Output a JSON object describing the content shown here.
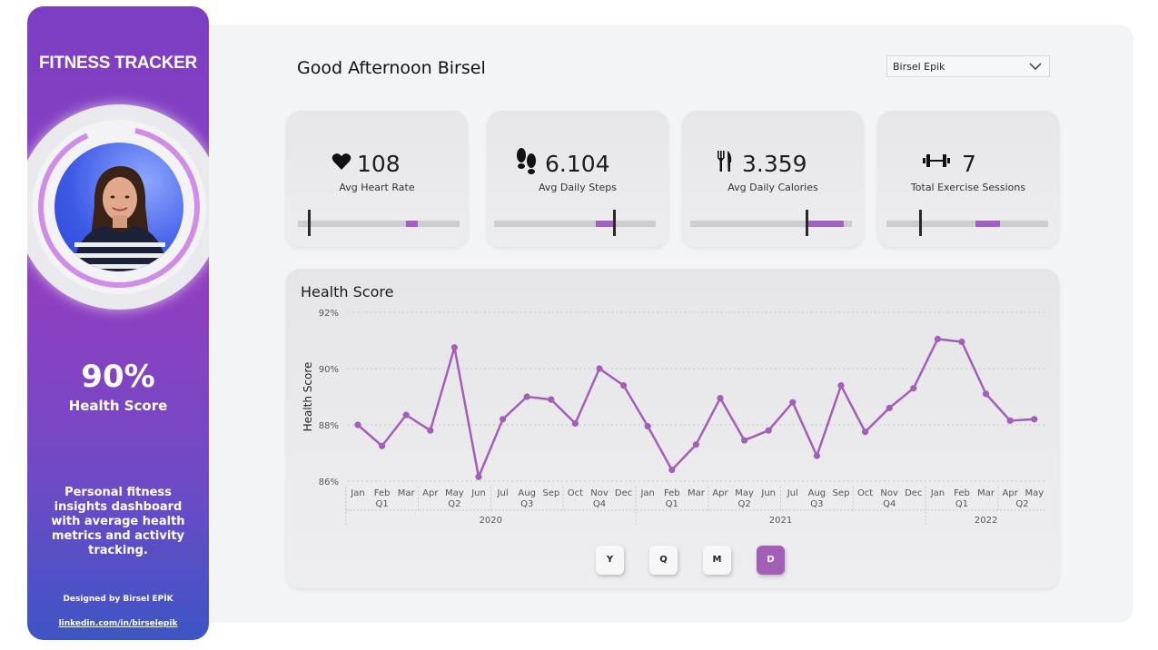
{
  "sidebar": {
    "title": "FITNESS TRACKER",
    "health_score_value": "90%",
    "health_score_label": "Health Score",
    "description": "Personal fitness insights dashboard with average health metrics and activity tracking.",
    "credit": "Designed by Birsel EPİK",
    "link": "linkedin.com/in/birselepik",
    "ring_progress": 0.9
  },
  "header": {
    "greeting": "Good Afternoon Birsel",
    "user_select": "Birsel Epik"
  },
  "kpis": [
    {
      "icon": "heart-icon",
      "value": "108",
      "label": "Avg Heart Rate",
      "fill_from": 0.67,
      "fill_to": 0.74,
      "target": 0.07
    },
    {
      "icon": "footsteps-icon",
      "value": "6.104",
      "label": "Avg Daily Steps",
      "fill_from": 0.63,
      "fill_to": 0.75,
      "target": 0.74
    },
    {
      "icon": "fork-knife-icon",
      "value": "3.359",
      "label": "Avg Daily Calories",
      "fill_from": 0.73,
      "fill_to": 0.95,
      "target": 0.72
    },
    {
      "icon": "dumbbell-icon",
      "value": "7",
      "label": "Total Exercise Sessions",
      "fill_from": 0.55,
      "fill_to": 0.7,
      "target": 0.21
    }
  ],
  "chart_data": {
    "type": "line",
    "title": "Health Score",
    "ylabel": "Health Score",
    "xlabel": "",
    "ylim": [
      86,
      92
    ],
    "yticks": [
      "86%",
      "88%",
      "90%",
      "92%"
    ],
    "grid": true,
    "color": "#a35fb8",
    "months": [
      "Jan",
      "Feb",
      "Mar",
      "Apr",
      "May",
      "Jun",
      "Jul",
      "Aug",
      "Sep",
      "Oct",
      "Nov",
      "Dec",
      "Jan",
      "Feb",
      "Mar",
      "Apr",
      "May",
      "Jun",
      "Jul",
      "Aug",
      "Sep",
      "Oct",
      "Nov",
      "Dec",
      "Jan",
      "Feb",
      "Mar",
      "Apr",
      "May"
    ],
    "quarters": [
      {
        "label": "Q1",
        "start": 0,
        "end": 2
      },
      {
        "label": "Q2",
        "start": 3,
        "end": 5
      },
      {
        "label": "Q3",
        "start": 6,
        "end": 8
      },
      {
        "label": "Q4",
        "start": 9,
        "end": 11
      },
      {
        "label": "Q1",
        "start": 12,
        "end": 14
      },
      {
        "label": "Q2",
        "start": 15,
        "end": 17
      },
      {
        "label": "Q3",
        "start": 18,
        "end": 20
      },
      {
        "label": "Q4",
        "start": 21,
        "end": 23
      },
      {
        "label": "Q1",
        "start": 24,
        "end": 26
      },
      {
        "label": "Q2",
        "start": 27,
        "end": 28
      }
    ],
    "years": [
      {
        "label": "2020",
        "start": 0,
        "end": 11
      },
      {
        "label": "2021",
        "start": 12,
        "end": 23
      },
      {
        "label": "2022",
        "start": 24,
        "end": 28
      }
    ],
    "series": [
      {
        "values": [
          88.0,
          87.25,
          88.35,
          87.8,
          90.75,
          86.15,
          88.2,
          89.0,
          88.9,
          88.05,
          90.0,
          89.4,
          87.95,
          86.4,
          87.3,
          88.95,
          87.45,
          87.8,
          88.8,
          86.9,
          89.4,
          87.75,
          88.6,
          89.3,
          91.05,
          90.95,
          89.1,
          88.15,
          88.2
        ]
      }
    ]
  },
  "granularity_buttons": [
    {
      "label": "Y",
      "active": false
    },
    {
      "label": "Q",
      "active": false
    },
    {
      "label": "M",
      "active": false
    },
    {
      "label": "D",
      "active": true
    }
  ]
}
